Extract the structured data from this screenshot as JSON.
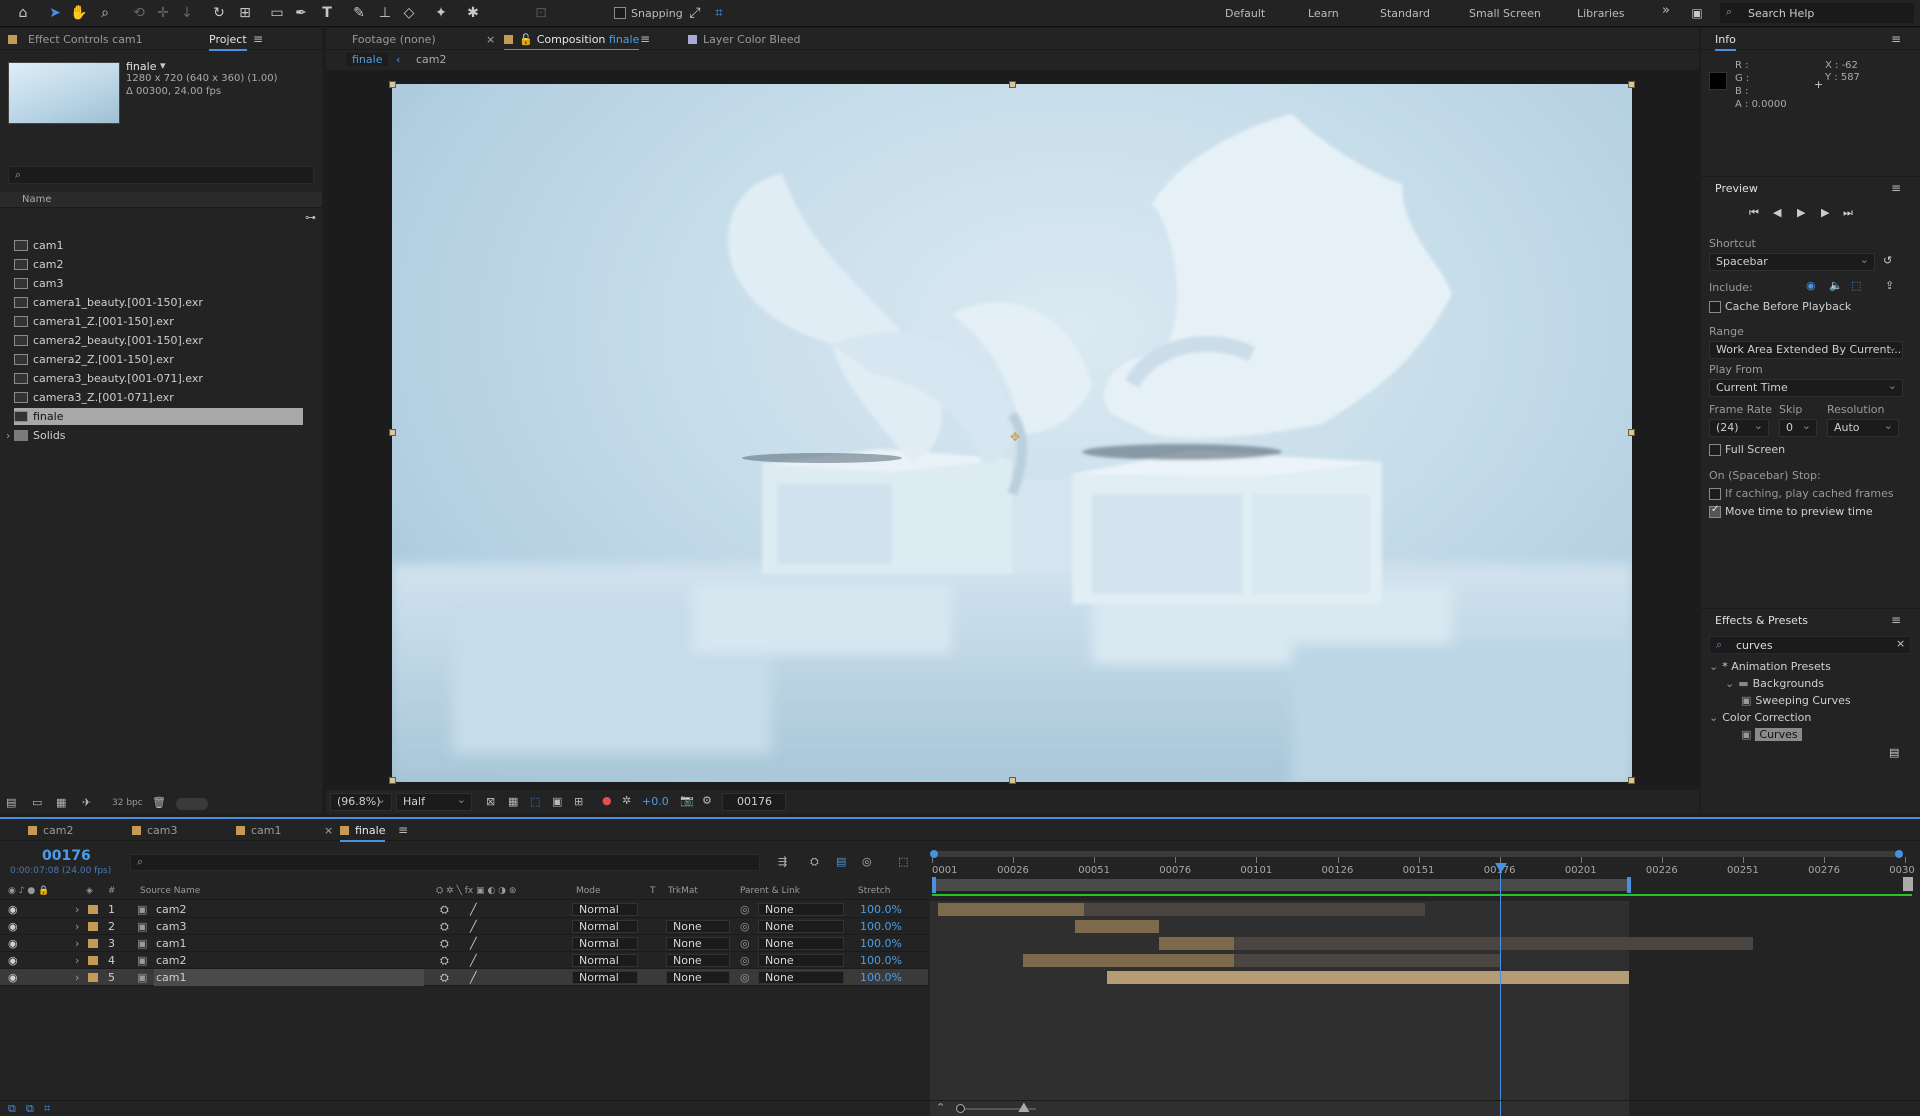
{
  "toolbar": {
    "snapping_label": "Snapping",
    "workspaces": [
      "Default",
      "Learn",
      "Standard",
      "Small Screen",
      "Libraries"
    ],
    "search_help_placeholder": "Search Help"
  },
  "left_panel": {
    "tabs": [
      "Effect Controls cam1",
      "Project"
    ],
    "comp_name": "finale",
    "comp_info_line1": "1280 x 720  (640 x 360) (1.00)",
    "comp_info_line2": "Δ 00300, 24.00 fps",
    "column_header": "Name",
    "items": [
      {
        "name": "cam1",
        "type": "comp"
      },
      {
        "name": "cam2",
        "type": "comp"
      },
      {
        "name": "cam3",
        "type": "comp"
      },
      {
        "name": "camera1_beauty.[001-150].exr",
        "type": "seq"
      },
      {
        "name": "camera1_Z.[001-150].exr",
        "type": "seq"
      },
      {
        "name": "camera2_beauty.[001-150].exr",
        "type": "seq"
      },
      {
        "name": "camera2_Z.[001-150].exr",
        "type": "seq"
      },
      {
        "name": "camera3_beauty.[001-071].exr",
        "type": "seq"
      },
      {
        "name": "camera3_Z.[001-071].exr",
        "type": "seq"
      },
      {
        "name": "finale",
        "type": "comp",
        "selected": true
      },
      {
        "name": "Solids",
        "type": "folder"
      }
    ],
    "bpc_label": "32 bpc"
  },
  "viewer_panel": {
    "footage_tab": "Footage (none)",
    "composition_tab_prefix": "Composition",
    "composition_tab_name": "finale",
    "layer_tab": "Layer Color Bleed",
    "breadcrumbs": [
      "finale",
      "cam2"
    ],
    "magnification": "(96.8%)",
    "resolution": "Half",
    "exposure": "+0.0",
    "current_frame": "00176"
  },
  "info_panel": {
    "title": "Info",
    "r": "R :",
    "g": "G :",
    "b": "B :",
    "a": "A :  0.0000",
    "x": "X : -62",
    "y": "Y : 587"
  },
  "preview_panel": {
    "title": "Preview",
    "shortcut_label": "Shortcut",
    "shortcut_value": "Spacebar",
    "include_label": "Include:",
    "cache_label": "Cache Before Playback",
    "cache_checked": false,
    "range_label": "Range",
    "range_value": "Work Area Extended By Current...",
    "play_from_label": "Play From",
    "play_from_value": "Current Time",
    "frame_rate_label": "Frame Rate",
    "frame_rate_value": "(24)",
    "skip_label": "Skip",
    "skip_value": "0",
    "resolution_label": "Resolution",
    "resolution_value": "Auto",
    "full_screen_label": "Full Screen",
    "full_screen_checked": false,
    "stop_label": "On (Spacebar) Stop:",
    "cached_frames_label": "If caching, play cached frames",
    "cached_frames_checked": false,
    "move_time_label": "Move time to preview time",
    "move_time_checked": true
  },
  "effects_panel": {
    "title": "Effects & Presets",
    "search_value": "curves",
    "tree": [
      {
        "label": "* Animation Presets",
        "indent": 0,
        "kind": "group"
      },
      {
        "label": "Backgrounds",
        "indent": 1,
        "kind": "folder"
      },
      {
        "label": "Sweeping Curves",
        "indent": 2,
        "kind": "preset"
      },
      {
        "label": "Color Correction",
        "indent": 0,
        "kind": "group"
      },
      {
        "label": "Curves",
        "indent": 2,
        "kind": "effect",
        "selected": true
      }
    ]
  },
  "timeline": {
    "tabs": [
      "cam2",
      "cam3",
      "cam1",
      "finale"
    ],
    "active_tab": "finale",
    "current_time": "00176",
    "current_time_sub": "0:00:07:08 (24.00 fps)",
    "columns": {
      "hash": "#",
      "source_name": "Source Name",
      "mode": "Mode",
      "t": "T",
      "trkmat": "TrkMat",
      "parent": "Parent & Link",
      "stretch": "Stretch"
    },
    "layers": [
      {
        "num": "1",
        "name": "cam2",
        "mode": "Normal",
        "trkmat": "",
        "parent": "None",
        "stretch": "100.0%"
      },
      {
        "num": "2",
        "name": "cam3",
        "mode": "Normal",
        "trkmat": "None",
        "parent": "None",
        "stretch": "100.0%"
      },
      {
        "num": "3",
        "name": "cam1",
        "mode": "Normal",
        "trkmat": "None",
        "parent": "None",
        "stretch": "100.0%"
      },
      {
        "num": "4",
        "name": "cam2",
        "mode": "Normal",
        "trkmat": "None",
        "parent": "None",
        "stretch": "100.0%"
      },
      {
        "num": "5",
        "name": "cam1",
        "mode": "Normal",
        "trkmat": "None",
        "parent": "None",
        "stretch": "100.0%",
        "selected": true
      }
    ],
    "ruler_ticks": [
      "0001",
      "00026",
      "00051",
      "00076",
      "00101",
      "00126",
      "00151",
      "00176",
      "00201",
      "00226",
      "00251",
      "00276",
      "0030"
    ],
    "frame_start": 1,
    "frame_end": 300,
    "work_area_end_frame": 216,
    "bars": [
      {
        "start": 3,
        "end": 48,
        "active_end": 153
      },
      {
        "start": 45,
        "end": 71,
        "active_end": 71
      },
      {
        "start": 71,
        "end": 94,
        "active_end": 254
      },
      {
        "start": 29,
        "end": 94,
        "active_end": 176
      },
      {
        "start": 55,
        "end": 216,
        "active_end": 216
      }
    ]
  },
  "colors": {
    "accent": "#4a90e2",
    "label_orange": "#c49a56",
    "bar_clip": "#7d6a4d",
    "bar_selected": "#b59c74",
    "work_area": "#25c325"
  }
}
